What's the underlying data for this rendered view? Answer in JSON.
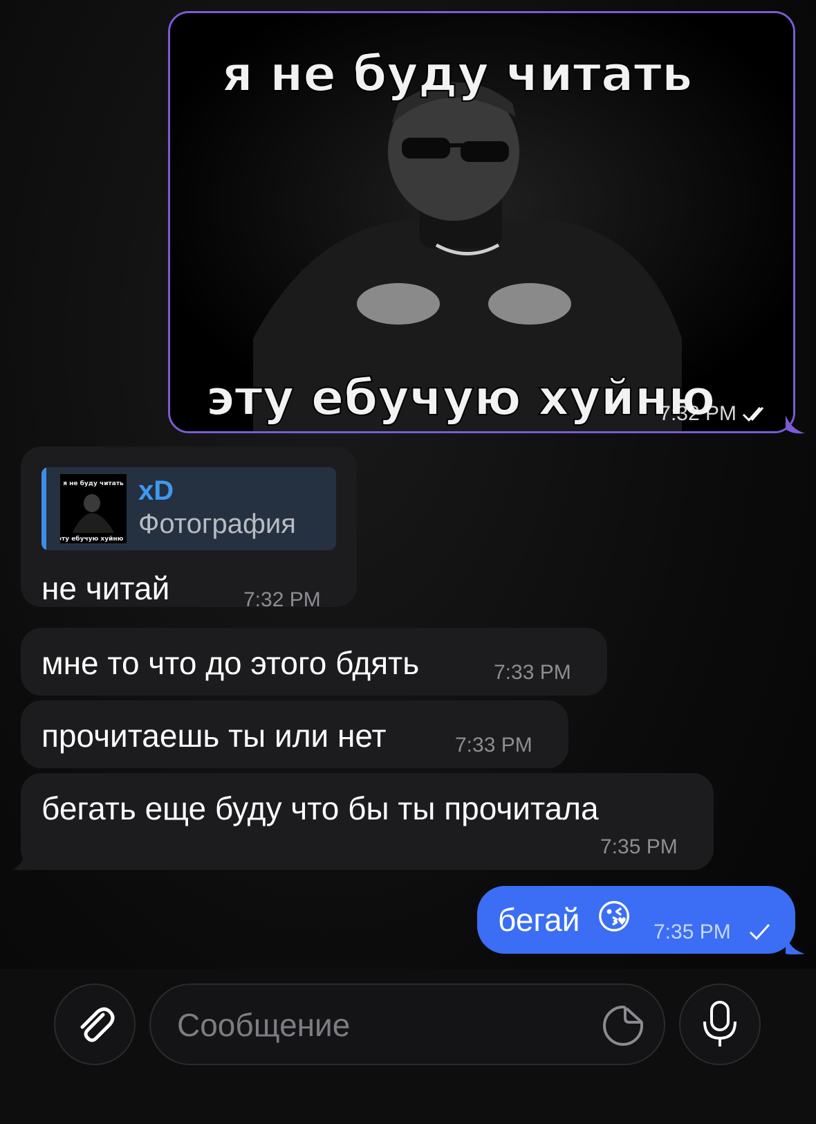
{
  "photo_message": {
    "meme_top": "я не буду читать",
    "meme_bottom": "эту ебучую хуйню",
    "time": "7:32 PM"
  },
  "messages_incoming": [
    {
      "reply": {
        "name": "xD",
        "subtitle": "Фотография"
      },
      "text": "не читай",
      "time": "7:32 PM"
    },
    {
      "text": "мне то что до этого бдять",
      "time": "7:33 PM"
    },
    {
      "text": "прочитаешь ты или нет",
      "time": "7:33 PM"
    },
    {
      "text": "бегать еще буду что бы ты прочитала",
      "time": "7:35 PM"
    }
  ],
  "message_outgoing": {
    "text": "бегай",
    "emoji": "😘",
    "time": "7:35 PM"
  },
  "composer": {
    "placeholder": "Сообщение"
  },
  "colors": {
    "accent": "#3b6ef5",
    "bubble_in": "#1c1c1e",
    "photo_border": "#7b5bd6",
    "reply_name": "#3d9aef"
  }
}
